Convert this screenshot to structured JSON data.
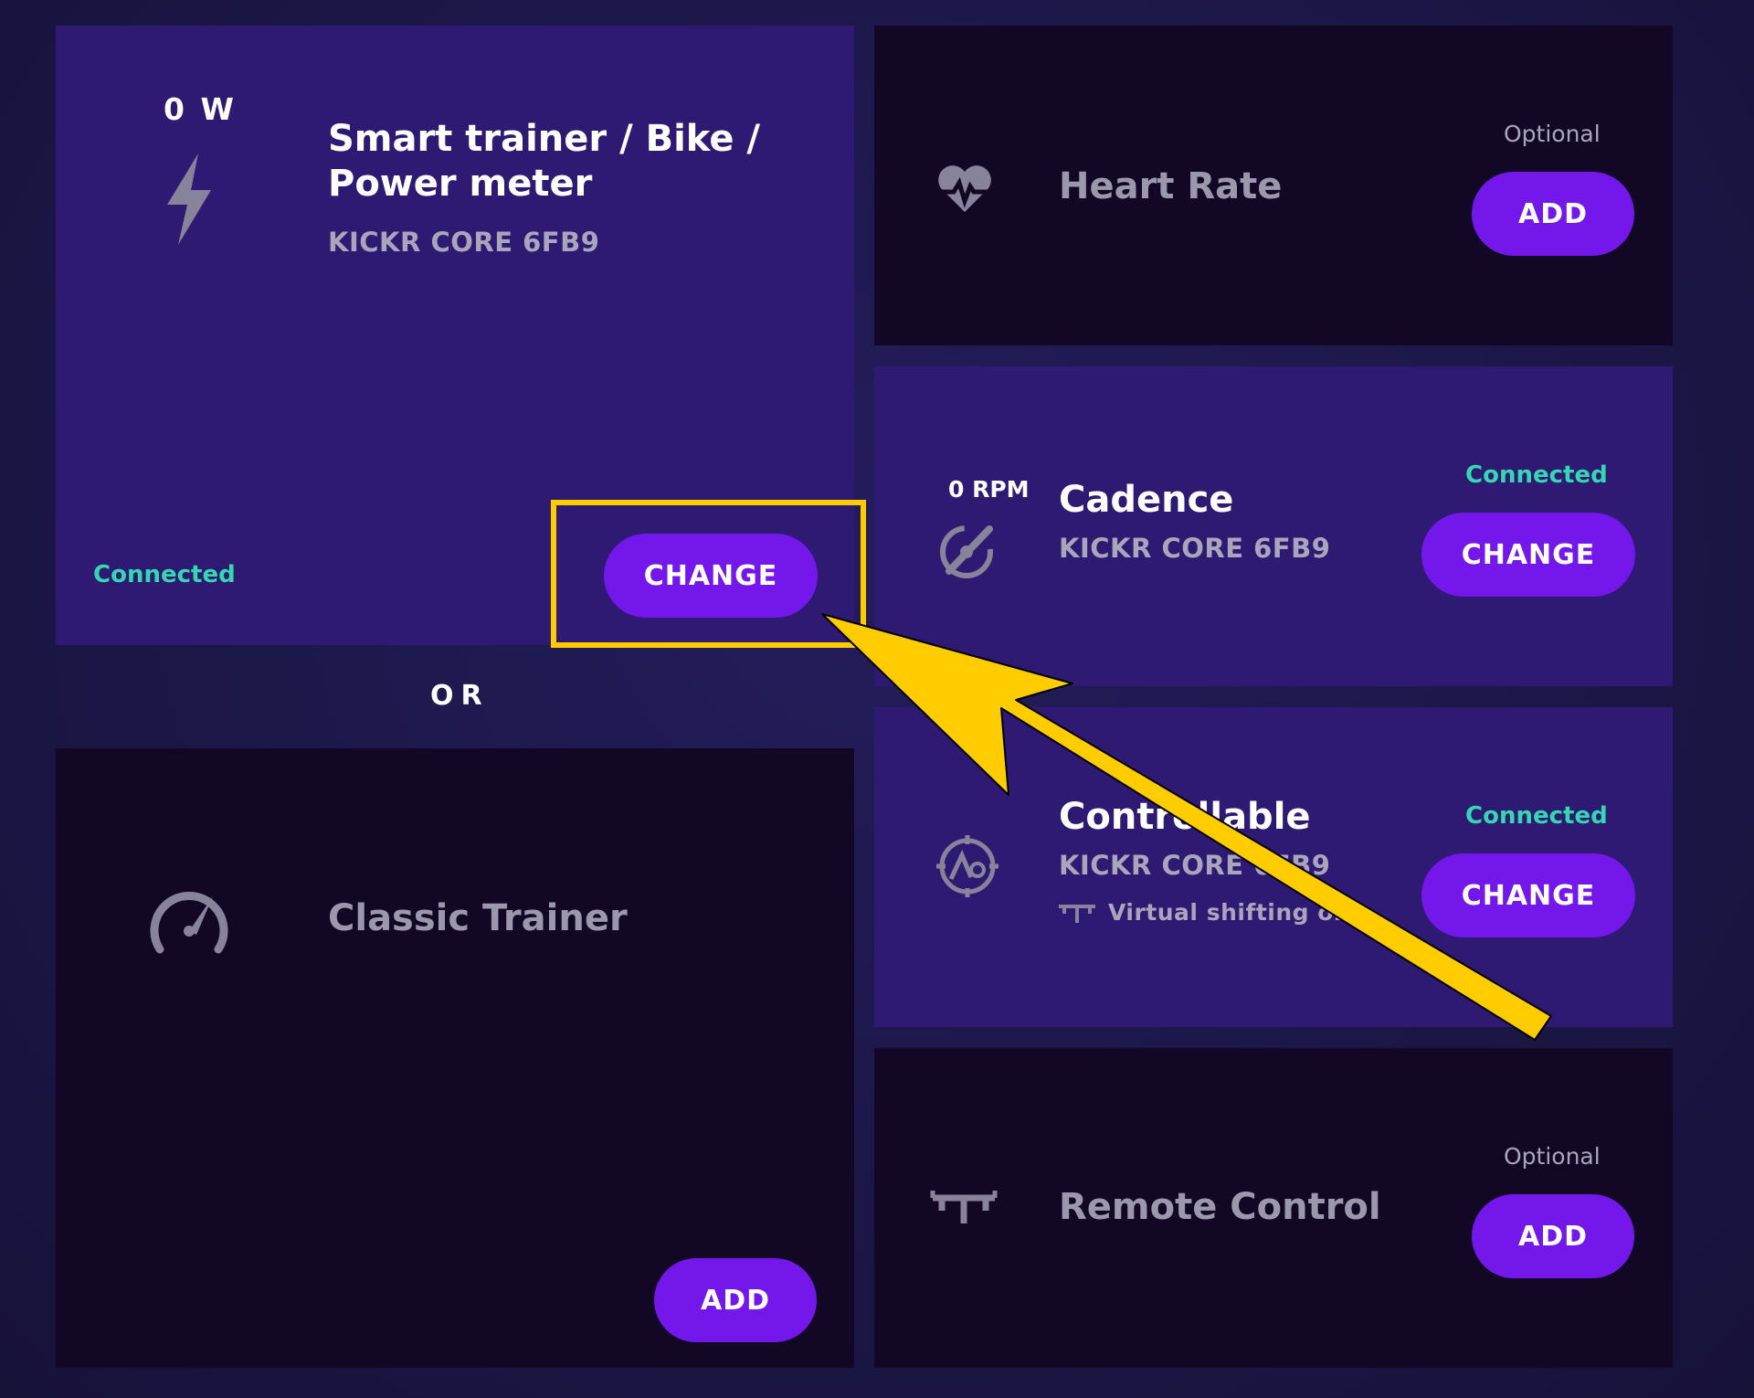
{
  "colors": {
    "accent": "#7317ea",
    "connected": "#35d6b2",
    "highlight": "#ffcc00",
    "active_card": "#2f1a73",
    "inactive_card": "#120826"
  },
  "power_card": {
    "metric": "0 W",
    "title_line1": "Smart trainer / Bike /",
    "title_line2": "Power meter",
    "device": "KICKR CORE 6FB9",
    "status": "Connected",
    "button": "CHANGE",
    "icon": "lightning-bolt-icon"
  },
  "or_label": "OR",
  "classic_card": {
    "title": "Classic Trainer",
    "button": "ADD",
    "icon": "speedometer-icon"
  },
  "heart_rate_card": {
    "title": "Heart Rate",
    "status": "Optional",
    "button": "ADD",
    "icon": "heart-rate-icon"
  },
  "cadence_card": {
    "metric": "0 RPM",
    "title": "Cadence",
    "device": "KICKR CORE 6FB9",
    "status": "Connected",
    "button": "CHANGE",
    "icon": "cadence-icon"
  },
  "controllable_card": {
    "title": "Controllable",
    "device": "KICKR CORE 6FB9",
    "note": "Virtual shifting on",
    "status": "Connected",
    "button": "CHANGE",
    "icon": "controllable-trainer-icon",
    "note_icon": "handlebar-icon"
  },
  "remote_card": {
    "title": "Remote Control",
    "status": "Optional",
    "button": "ADD",
    "icon": "handlebar-remote-icon"
  }
}
